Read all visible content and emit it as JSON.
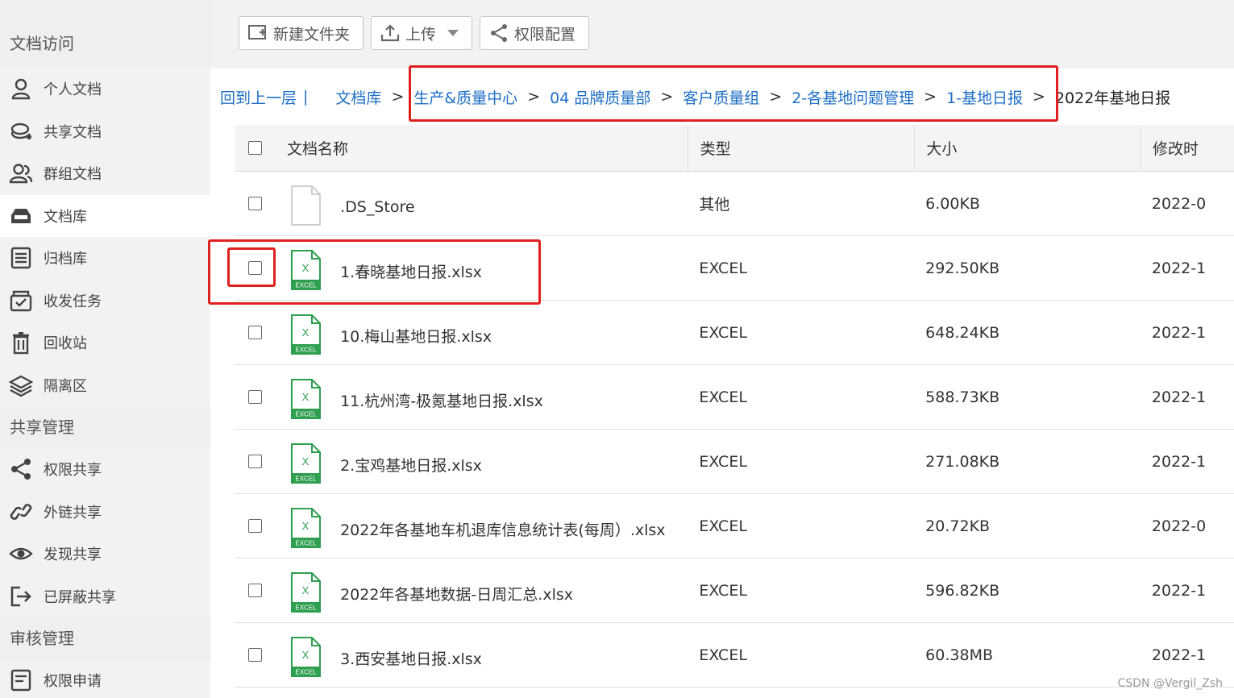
{
  "sidebar": {
    "section_docs": "文档访问",
    "items_docs": [
      {
        "label": "个人文档",
        "icon": "person-icon"
      },
      {
        "label": "共享文档",
        "icon": "shared-docs-icon"
      },
      {
        "label": "群组文档",
        "icon": "group-icon"
      },
      {
        "label": "文档库",
        "icon": "library-icon"
      },
      {
        "label": "归档库",
        "icon": "archive-icon"
      },
      {
        "label": "收发任务",
        "icon": "task-box-icon"
      },
      {
        "label": "回收站",
        "icon": "trash-icon"
      },
      {
        "label": "隔离区",
        "icon": "layers-icon"
      }
    ],
    "section_share": "共享管理",
    "items_share": [
      {
        "label": "权限共享",
        "icon": "share-icon"
      },
      {
        "label": "外链共享",
        "icon": "link-icon"
      },
      {
        "label": "发现共享",
        "icon": "eye-icon"
      },
      {
        "label": "已屏蔽共享",
        "icon": "exit-icon"
      }
    ],
    "section_audit": "审核管理",
    "items_audit": [
      {
        "label": "权限申请",
        "icon": "request-icon"
      }
    ],
    "active": "文档库"
  },
  "toolbar": {
    "new_folder": "新建文件夹",
    "upload": "上传",
    "permission_config": "权限配置"
  },
  "breadcrumb": {
    "back": "回到上一层",
    "back_sep": "|",
    "root": "文档库",
    "sep": ">",
    "path": [
      "生产&质量中心",
      "04 品牌质量部",
      "客户质量组",
      "2-各基地问题管理",
      "1-基地日报"
    ],
    "current": "2022年基地日报"
  },
  "table": {
    "headers": {
      "name": "文档名称",
      "type": "类型",
      "size": "大小",
      "time": "修改时"
    },
    "rows": [
      {
        "name": ".DS_Store",
        "type": "其他",
        "size": "6.00KB",
        "time": "2022-0",
        "kind": "blank"
      },
      {
        "name": "1.春晓基地日报.xlsx",
        "type": "EXCEL",
        "size": "292.50KB",
        "time": "2022-1",
        "kind": "excel"
      },
      {
        "name": "10.梅山基地日报.xlsx",
        "type": "EXCEL",
        "size": "648.24KB",
        "time": "2022-1",
        "kind": "excel"
      },
      {
        "name": "11.杭州湾-极氪基地日报.xlsx",
        "type": "EXCEL",
        "size": "588.73KB",
        "time": "2022-1",
        "kind": "excel"
      },
      {
        "name": "2.宝鸡基地日报.xlsx",
        "type": "EXCEL",
        "size": "271.08KB",
        "time": "2022-1",
        "kind": "excel"
      },
      {
        "name": "2022年各基地车机退库信息统计表(每周）.xlsx",
        "type": "EXCEL",
        "size": "20.72KB",
        "time": "2022-0",
        "kind": "excel"
      },
      {
        "name": "2022年各基地数据-日周汇总.xlsx",
        "type": "EXCEL",
        "size": "596.82KB",
        "time": "2022-1",
        "kind": "excel"
      },
      {
        "name": "3.西安基地日报.xlsx",
        "type": "EXCEL",
        "size": "60.38MB",
        "time": "2022-1",
        "kind": "excel"
      }
    ]
  },
  "excel_icon_caption": "EXCEL",
  "excel_icon_letter": "X",
  "watermark": "CSDN @Vergil_Zsh",
  "colors": {
    "link": "#1e6fc6",
    "highlight": "#e0201e",
    "excel": "#2e9e4f"
  }
}
